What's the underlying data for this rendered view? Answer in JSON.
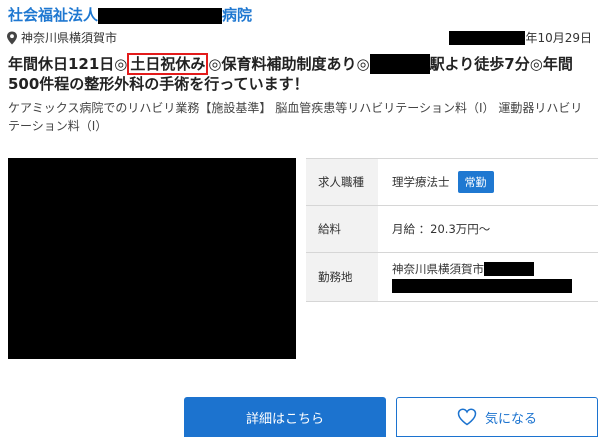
{
  "job": {
    "employer_prefix": "社会福祉法人",
    "employer_suffix": "病院",
    "location": "神奈川県横須賀市",
    "date": "年10月29日",
    "headline": {
      "part1": "年間休日121日◎",
      "highlight": "土日祝休み",
      "part2": "◎保育料補助制度あり◎",
      "part3": "駅より徒歩7分◎年間500件程の整形外科の手術を行っています！"
    },
    "description": "ケアミックス病院でのリハビリ業務【施設基準】 脳血管疾患等リハビリテーション料（Ⅰ） 運動器リハビリテーション料（Ⅰ）"
  },
  "info_table": {
    "job_type_label": "求人職種",
    "job_type_value": "理学療法士",
    "employment_badge": "常勤",
    "salary_label": "給料",
    "salary_value": "月給 ：20.3万円〜",
    "workplace_label": "勤務地",
    "workplace_value": "神奈川県横須賀市"
  },
  "buttons": {
    "detail_label": "詳細はこちら",
    "favorite_label": "気になる"
  },
  "colors": {
    "accent": "#1f78d1",
    "highlight_border": "#e31b1b",
    "redaction": "#000000"
  },
  "icons": {
    "location": "map-pin-icon",
    "favorite": "heart-icon"
  }
}
